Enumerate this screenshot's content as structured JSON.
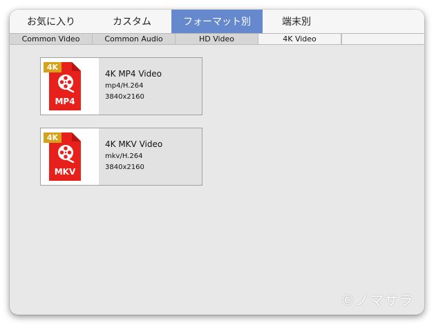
{
  "top_tabs": [
    {
      "label": "お気に入り"
    },
    {
      "label": "カスタム"
    },
    {
      "label": "フォーマット別",
      "active": true
    },
    {
      "label": "端末別"
    }
  ],
  "sub_tabs": [
    {
      "label": "Common Video"
    },
    {
      "label": "Common Audio"
    },
    {
      "label": "HD Video"
    },
    {
      "label": "4K Video",
      "active": true
    }
  ],
  "cards": [
    {
      "badge": "4K",
      "format": "MP4",
      "title": "4K MP4 Video",
      "codec": "mp4/H.264",
      "resolution": "3840x2160",
      "icon": "mp4-file-icon"
    },
    {
      "badge": "4K",
      "format": "MKV",
      "title": "4K MKV Video",
      "codec": "mkv/H.264",
      "resolution": "3840x2160",
      "icon": "mkv-file-icon"
    }
  ],
  "watermark": "©ノマサラ",
  "colors": {
    "active_tab": "#6688cc",
    "file_icon_red": "#e8201c",
    "badge_gold": "#d6a21a",
    "panel": "#e8e8e8"
  }
}
